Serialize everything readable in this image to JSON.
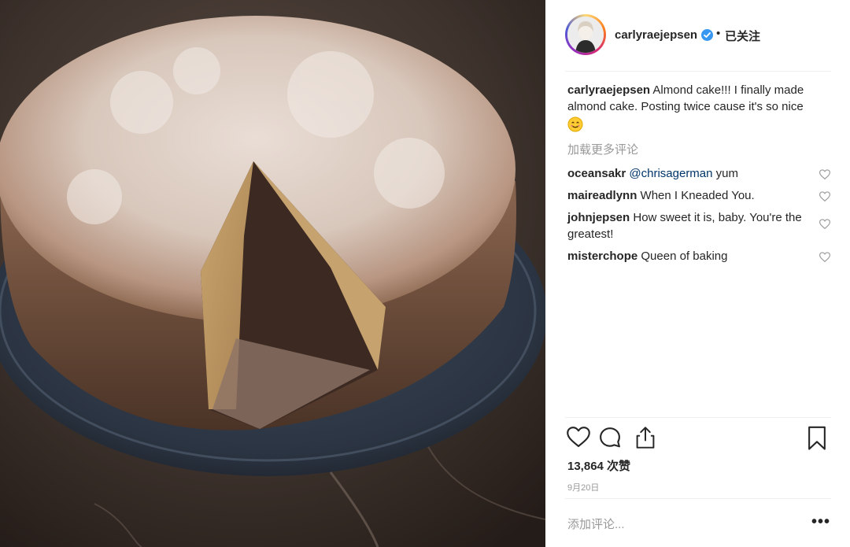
{
  "post": {
    "username": "carlyraejepsen",
    "verified": true,
    "separator": "•",
    "follow_status": "已关注",
    "caption": "Almond cake!!! I finally made almond cake. Posting twice cause it's so nice",
    "caption_emoji": "smiling-face-icon",
    "load_more_comments": "加载更多评论",
    "comments": [
      {
        "user": "oceansakr",
        "mention": "@chrisagerman",
        "text": " yum"
      },
      {
        "user": "maireadlynn",
        "text": "When I Kneaded You."
      },
      {
        "user": "johnjepsen",
        "text": "How sweet it is, baby. You're the greatest!"
      },
      {
        "user": "misterchope",
        "text": "Queen of baking"
      }
    ],
    "likes": "13,864 次赞",
    "date": "9月20日",
    "add_comment_placeholder": "添加评论...",
    "more_options": "•••"
  },
  "icons": {
    "like": "heart-icon",
    "comment": "comment-bubble-icon",
    "share": "share-icon",
    "save": "bookmark-icon"
  },
  "colors": {
    "verified_blue": "#3897f0",
    "mention_blue": "#003569",
    "muted_gray": "#999999",
    "text_dark": "#262626"
  }
}
